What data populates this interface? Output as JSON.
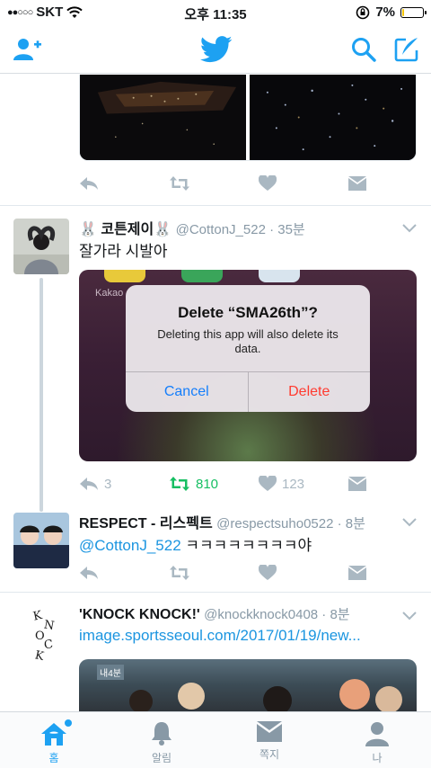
{
  "status_bar": {
    "carrier": "SKT",
    "time": "오후 11:35",
    "battery_text": "7%",
    "battery_level": 0.07,
    "battery_color": "#f5c400"
  },
  "nav": {
    "add_user_icon": "add-user-icon",
    "logo_icon": "twitter-bird-icon",
    "search_icon": "search-icon",
    "compose_icon": "compose-icon",
    "accent": "#1da1f2"
  },
  "tweets": [
    {
      "actions": {
        "reply": "",
        "retweet": "",
        "like": ""
      }
    },
    {
      "name": "🐰 코튼제이🐰",
      "handle": "@CottonJ_522 · 35분",
      "text": "잘가라 시발아",
      "media": {
        "app_label": "Kakao",
        "alert_title": "Delete “SMA26th”?",
        "alert_message": "Deleting this app will also delete its data.",
        "cancel_label": "Cancel",
        "delete_label": "Delete"
      },
      "actions": {
        "reply": "3",
        "retweet": "810",
        "like": "123"
      }
    },
    {
      "name": "RESPECT - 리스펙트",
      "handle": "@respectsuho0522 · 8분",
      "mention": "@CottonJ_522",
      "text": " ㅋㅋㅋㅋㅋㅋㅋㅋ야",
      "actions": {
        "reply": "",
        "retweet": "",
        "like": ""
      }
    },
    {
      "name": "'KNOCK KNOCK!'",
      "handle": "@knockknock0408 · 8분",
      "link": "image.sportsseoul.com/2017/01/19/new...",
      "avatar_text": "KNOCK",
      "photo_tag": "내4분"
    }
  ],
  "tabbar": {
    "items": [
      {
        "label": "홈",
        "icon": "home-icon",
        "active": true
      },
      {
        "label": "알림",
        "icon": "bell-icon",
        "active": false
      },
      {
        "label": "쪽지",
        "icon": "message-icon",
        "active": false
      },
      {
        "label": "나",
        "icon": "profile-icon",
        "active": false
      }
    ]
  }
}
